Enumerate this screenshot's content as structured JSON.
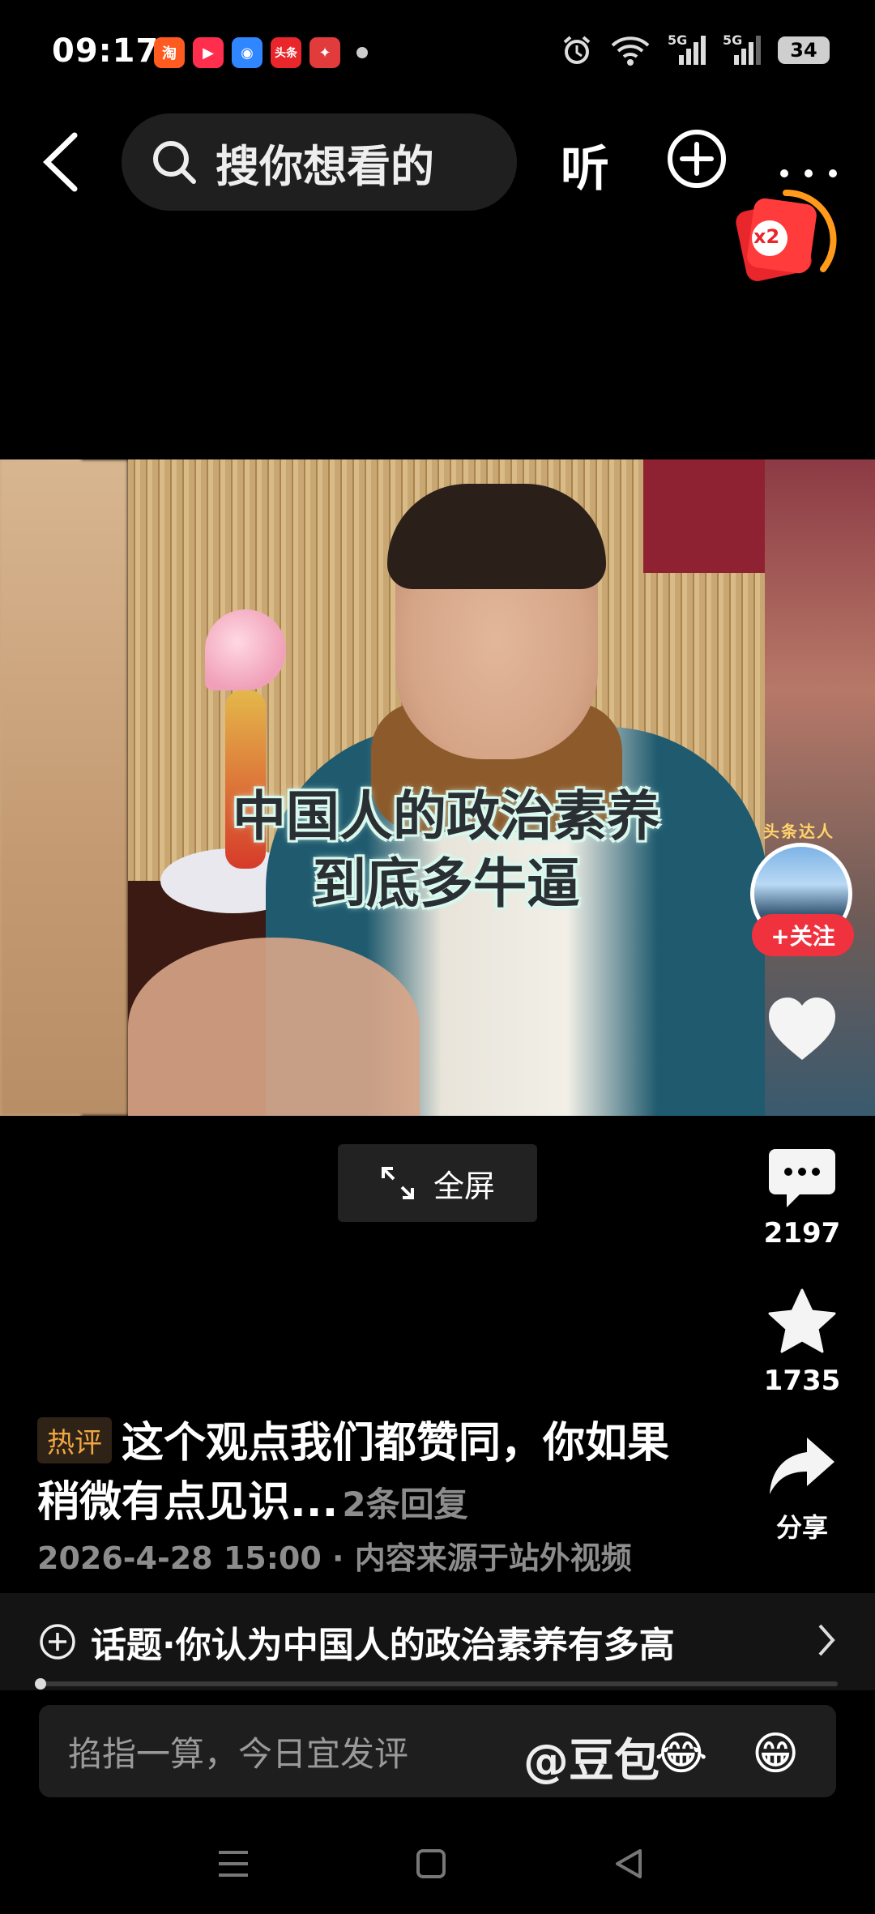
{
  "status_bar": {
    "time": "09:17",
    "app_icons": [
      {
        "name": "taobao-app-icon",
        "label": "淘",
        "color": "#ff5a1f"
      },
      {
        "name": "video-app-icon",
        "label": "▶",
        "color": "#ff2e4d"
      },
      {
        "name": "browser-app-icon",
        "label": "◉",
        "color": "#2f86ff"
      },
      {
        "name": "toutiao-app-icon",
        "label": "头条",
        "color": "#e8262b"
      },
      {
        "name": "event-app-icon",
        "label": "✦",
        "color": "#e23b3b"
      }
    ],
    "battery": "34",
    "network_1": "5G",
    "network_2": "5G"
  },
  "top_nav": {
    "search_placeholder": "搜你想看的",
    "listen_label": "听",
    "reward_badge": "x2"
  },
  "video": {
    "caption_line_1": "中国人的政治素养",
    "caption_line_2": "到底多牛逼",
    "fullscreen_label": "全屏"
  },
  "author": {
    "tag": "头条达人",
    "follow_label": "+关注"
  },
  "rail": {
    "comment_count": "2197",
    "favorite_count": "1735",
    "share_label": "分享"
  },
  "hot_comment": {
    "tag": "热评",
    "text": "这个观点我们都赞同，你如果稍微有点见识...",
    "replies": "2条回复",
    "meta": "2026-4-28 15:00 · 内容来源于站外视频"
  },
  "topic": {
    "text": "话题·你认为中国人的政治素养有多高"
  },
  "progress": {
    "fraction": 0.0
  },
  "comment_input": {
    "placeholder": "掐指一算，今日宜发评",
    "mention": "@豆包",
    "emoji_1": "😂",
    "emoji_2": "😁"
  },
  "colors": {
    "accent_red": "#f0323f",
    "hot_orange": "#f0a640",
    "reward_orange": "#ff9a1a"
  }
}
